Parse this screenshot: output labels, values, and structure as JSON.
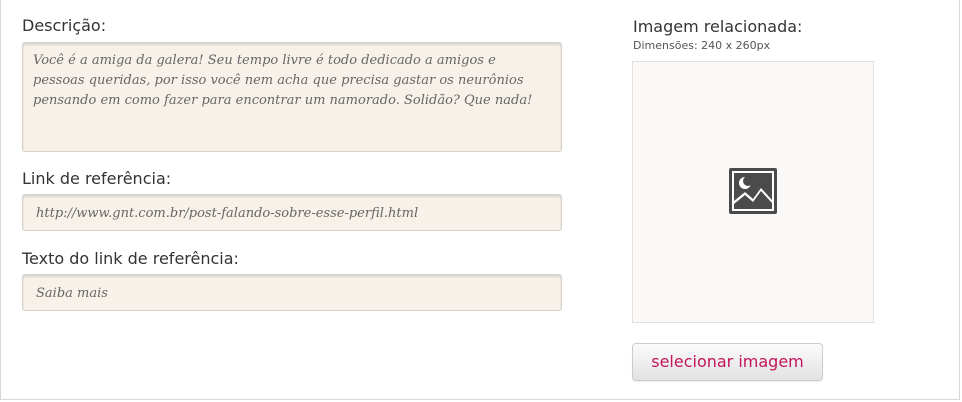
{
  "form": {
    "description_label": "Descrição:",
    "description_value": "Você é a amiga da galera! Seu tempo livre é todo dedicado a amigos e pessoas queridas, por isso você nem acha que precisa gastar os neurônios pensando em como fazer para encontrar um namorado. Solidão? Que nada!",
    "link_label": "Link de referência:",
    "link_value": "http://www.gnt.com.br/post-falando-sobre-esse-perfil.html",
    "link_text_label": "Texto do link de referência:",
    "link_text_value": "Saiba mais"
  },
  "image_panel": {
    "title": "Imagem relacionada:",
    "dimensions": "Dimensões: 240 x 260px",
    "placeholder_icon": "image-placeholder-icon",
    "select_button_label": "selecionar imagem"
  },
  "colors": {
    "field_background": "#f7f1ea",
    "button_text": "#c4145c"
  }
}
